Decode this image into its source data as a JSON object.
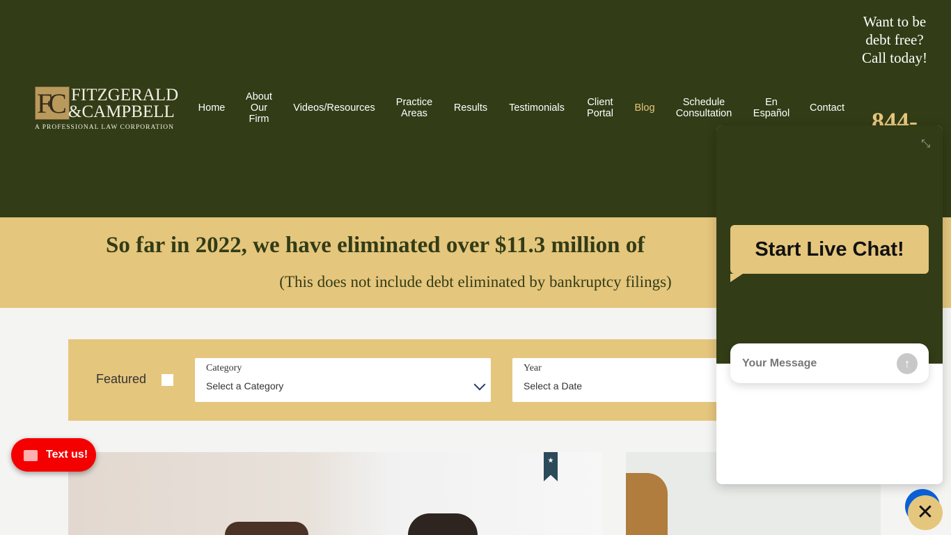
{
  "logo": {
    "mark": "FC",
    "line1": "FITZGERALD",
    "line2": "&CAMPBELL",
    "line3": "A PROFESSIONAL LAW CORPORATION"
  },
  "nav": [
    {
      "label": "Home"
    },
    {
      "label": "About\nOur\nFirm"
    },
    {
      "label": "Videos/Resources"
    },
    {
      "label": "Practice\nAreas"
    },
    {
      "label": "Results"
    },
    {
      "label": "Testimonials"
    },
    {
      "label": "Client\nPortal"
    },
    {
      "label": "Blog",
      "active": true
    },
    {
      "label": "Schedule\nConsultation"
    },
    {
      "label": "En\nEspañol"
    },
    {
      "label": "Contact"
    }
  ],
  "cta": {
    "text": "Want to be debt free? Call today!",
    "phone": "844-"
  },
  "banner": {
    "headline": "So far in 2022, we have eliminated over $11.3 million of",
    "note": "(This does not include debt eliminated by bankruptcy filings)"
  },
  "filters": {
    "featured_label": "Featured",
    "category_label": "Category",
    "category_value": "Select a Category",
    "year_label": "Year",
    "year_value": "Select a Date"
  },
  "textus": {
    "label": "Text us!"
  },
  "chat": {
    "title": "Start Live Chat!",
    "placeholder": "Your Message"
  },
  "colors": {
    "dark_green": "#323c16",
    "gold": "#e5c67d",
    "red": "#f50000"
  }
}
